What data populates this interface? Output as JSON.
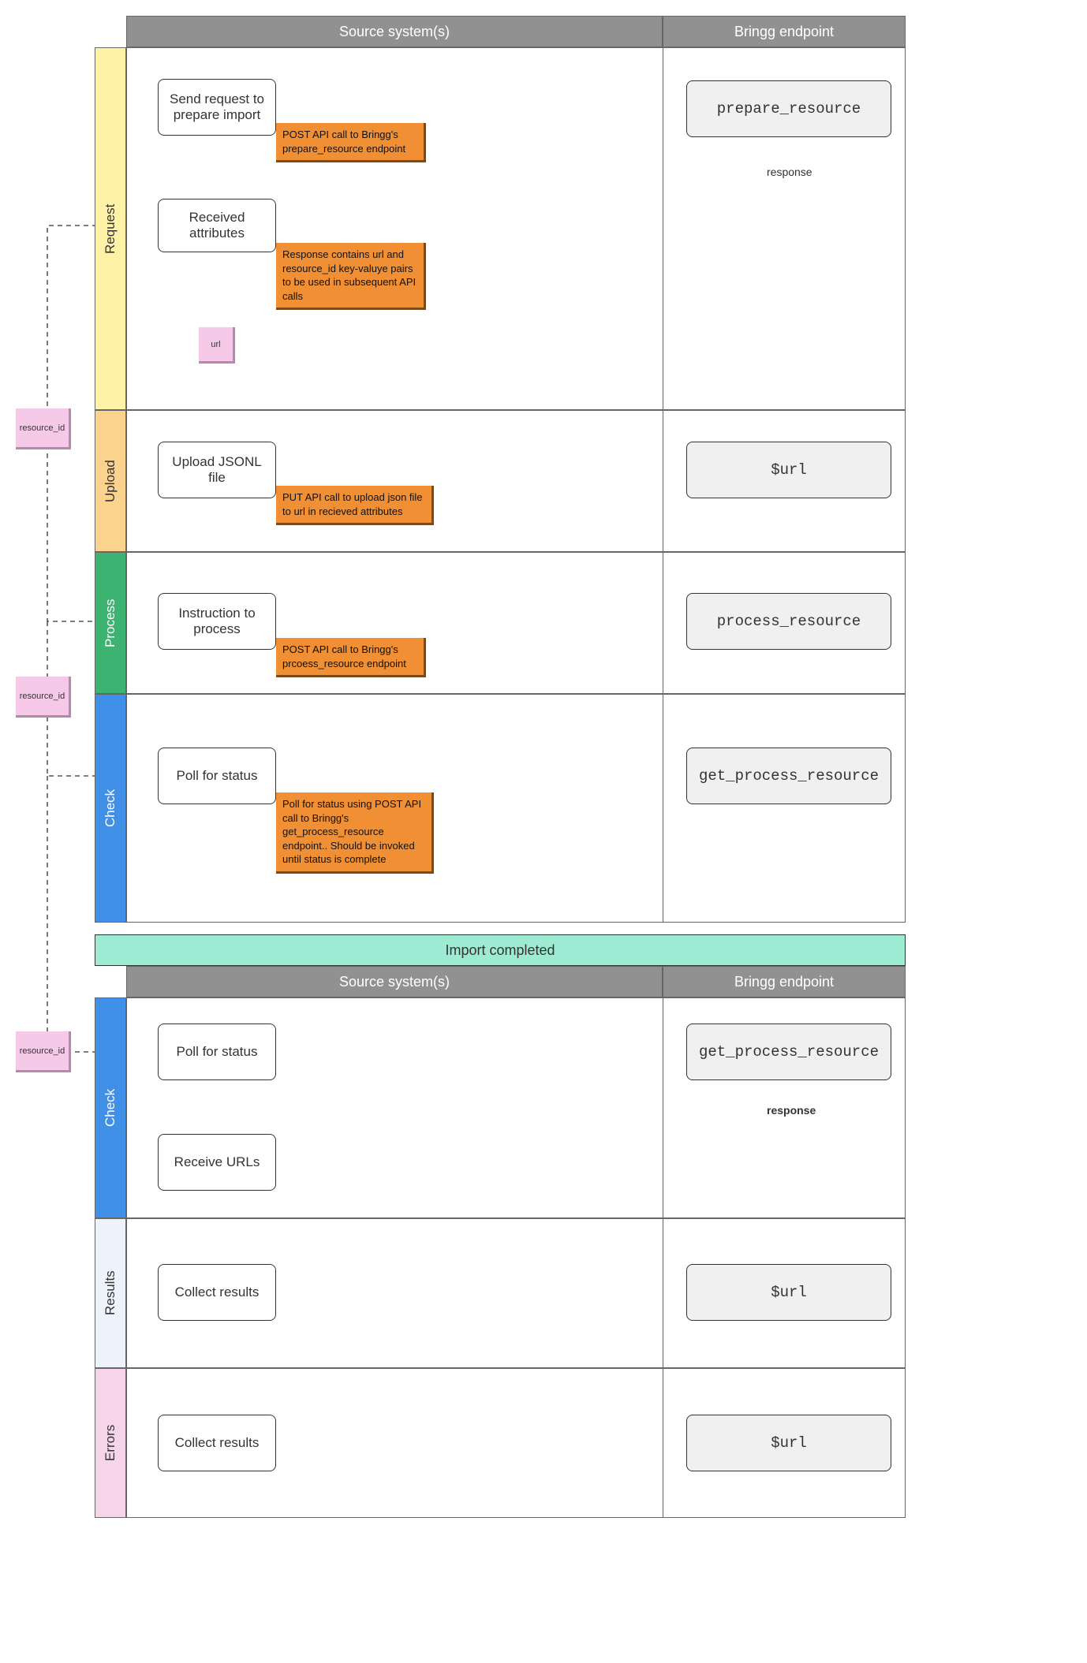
{
  "headers_top": {
    "source": "Source system(s)",
    "endpoint": "Bringg endpoint"
  },
  "separator": "Import completed",
  "headers_bottom": {
    "source": "Source system(s)",
    "endpoint": "Bringg endpoint"
  },
  "lanes_top": {
    "request": "Request",
    "upload": "Upload",
    "process": "Process",
    "check": "Check"
  },
  "lanes_bottom": {
    "check": "Check",
    "results": "Results",
    "errors": "Errors"
  },
  "boxes": {
    "send_request": "Send request to prepare import",
    "received_attributes": "Received attributes",
    "upload_jsonl": "Upload JSONL file",
    "instruction_process": "Instruction to process",
    "poll_status_1": "Poll for status",
    "poll_status_2": "Poll for status",
    "receive_urls": "Receive URLs",
    "collect_results_1": "Collect results",
    "collect_results_2": "Collect results"
  },
  "endpoints": {
    "prepare_resource": "prepare_resource",
    "url1": "$url",
    "process_resource": "process_resource",
    "get_process_resource_1": "get_process_resource",
    "get_process_resource_2": "get_process_resource",
    "url2": "$url",
    "url3": "$url"
  },
  "notes": {
    "n1": "POST API call to Bringg's prepare_resource endpoint",
    "n2": "Response contains url and resource_id key-valuye pairs to be used in subsequent API calls",
    "n3": "PUT API call to upload json file to url in recieved attributes",
    "n4": "POST API call to Bringg's prcoess_resource endpoint",
    "n5": "Poll for status using POST API call to Bringg's get_process_resource endpoint.. Should be invoked until status is complete"
  },
  "stickies": {
    "url": "url",
    "rid1": "resource_id",
    "rid2": "resource_id",
    "rid3": "resource_id"
  },
  "edge_labels": {
    "response1": "response",
    "response2": "response"
  }
}
